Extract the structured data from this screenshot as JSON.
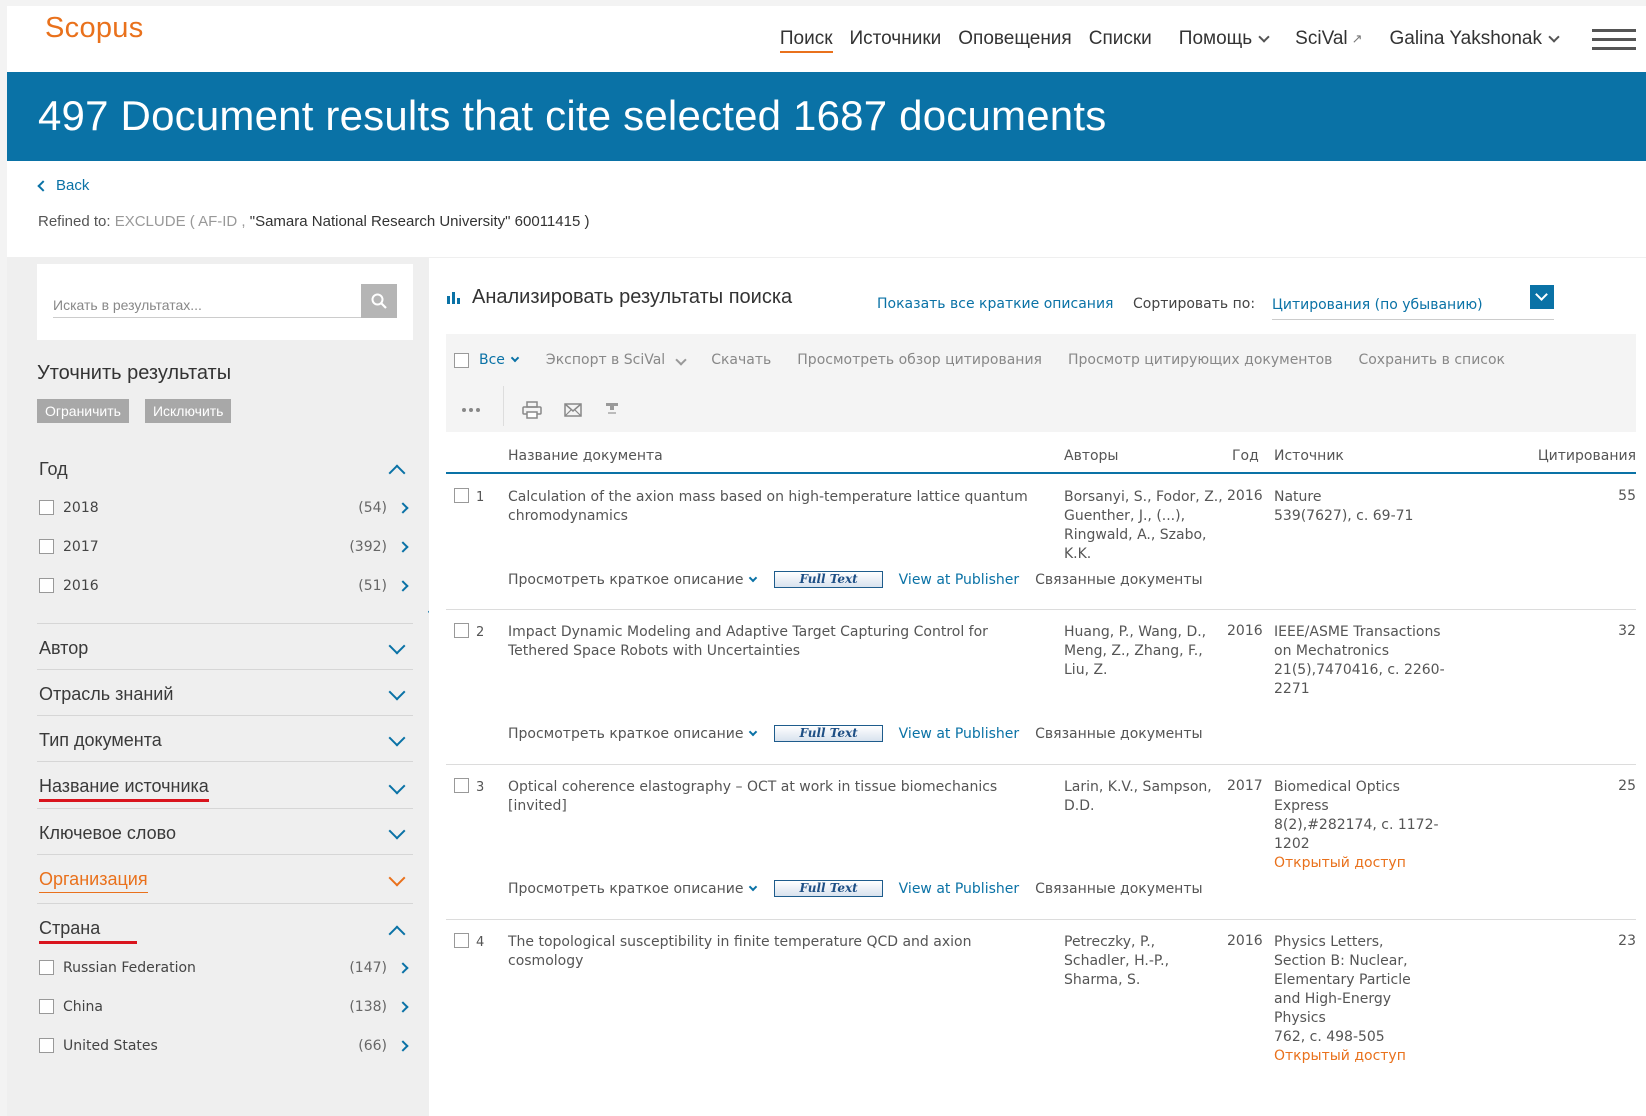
{
  "header": {
    "logo": "Scopus",
    "nav": [
      {
        "label": "Поиск",
        "active": true
      },
      {
        "label": "Источники"
      },
      {
        "label": "Оповещения"
      },
      {
        "label": "Списки"
      },
      {
        "label": "Помощь"
      },
      {
        "label": "SciVal"
      },
      {
        "label": "Galina Yakshonak"
      }
    ]
  },
  "banner": {
    "title": "497 Document results that cite selected 1687 documents"
  },
  "crumb": {
    "back": "Back",
    "refined_prefix": "Refined to:",
    "refined_rule": "EXCLUDE ( AF-ID ,",
    "refined_query": "\"Samara National Research University\"",
    "refined_id": "60011415 )"
  },
  "sidebar": {
    "search_placeholder": "Искать в результатах...",
    "refine_title": "Уточнить результаты",
    "limit": "Ограничить",
    "exclude": "Исключить",
    "year": {
      "label": "Год",
      "items": [
        {
          "label": "2018",
          "count": "(54)"
        },
        {
          "label": "2017",
          "count": "(392)"
        },
        {
          "label": "2016",
          "count": "(51)"
        }
      ]
    },
    "facets": {
      "author": "Автор",
      "subject": "Отрасль знаний",
      "doctype": "Тип документа",
      "source": "Название источника",
      "keyword": "Ключевое слово",
      "affiliation": "Организация"
    },
    "country": {
      "label": "Страна",
      "items": [
        {
          "label": "Russian Federation",
          "count": "(147)"
        },
        {
          "label": "China",
          "count": "(138)"
        },
        {
          "label": "United States",
          "count": "(66)"
        }
      ]
    }
  },
  "results": {
    "analyze": "Анализировать результаты поиска",
    "show_all": "Показать все краткие описания",
    "sort_label": "Сортировать по:",
    "sort_value": "Цитирования (по убыванию)",
    "toolbar": {
      "all": "Все",
      "export": "Экспорт в SciVal",
      "download": "Скачать",
      "citation_overview": "Просмотреть обзор цитирования",
      "citing_docs": "Просмотр цитирующих документов",
      "save": "Сохранить в список"
    },
    "columns": {
      "title": "Название документа",
      "authors": "Авторы",
      "year": "Год",
      "source": "Источник",
      "cites": "Цитирования"
    },
    "action_labels": {
      "abstract": "Просмотреть краткое описание",
      "fulltext": "Full Text",
      "publisher": "View at Publisher",
      "related": "Связанные документы"
    },
    "rows": [
      {
        "num": "1",
        "title": "Calculation of the axion mass based on high-temperature lattice quantum chromodynamics",
        "authors": "Borsanyi, S., Fodor, Z., Guenther, J., (...), Ringwald, A., Szabo, K.K.",
        "year": "2016",
        "source": "Nature",
        "source_detail": "539(7627), c. 69-71",
        "open_access": "",
        "cites": "55"
      },
      {
        "num": "2",
        "title": "Impact Dynamic Modeling and Adaptive Target Capturing Control for Tethered Space Robots with Uncertainties",
        "authors": "Huang, P., Wang, D., Meng, Z., Zhang, F., Liu, Z.",
        "year": "2016",
        "source": "IEEE/ASME Transactions on Mechatronics",
        "source_detail": "21(5),7470416, c. 2260-2271",
        "open_access": "",
        "cites": "32"
      },
      {
        "num": "3",
        "title": "Optical coherence elastography – OCT at work in tissue biomechanics [invited]",
        "authors": "Larin, K.V., Sampson, D.D.",
        "year": "2017",
        "source": "Biomedical Optics Express",
        "source_detail": "8(2),#282174, c. 1172-1202",
        "open_access": "Открытый доступ",
        "cites": "25"
      },
      {
        "num": "4",
        "title": "The topological susceptibility in finite temperature QCD and axion cosmology",
        "authors": "Petreczky, P., Schadler, H.-P., Sharma, S.",
        "year": "2016",
        "source": "Physics Letters, Section B: Nuclear, Elementary Particle and High-Energy Physics",
        "source_detail": "762, c. 498-505",
        "open_access": "Открытый доступ",
        "cites": "23"
      }
    ]
  },
  "colors": {
    "brand_orange": "#e9711c",
    "brand_blue": "#0a72a6",
    "highlight_red": "#d9141d"
  }
}
